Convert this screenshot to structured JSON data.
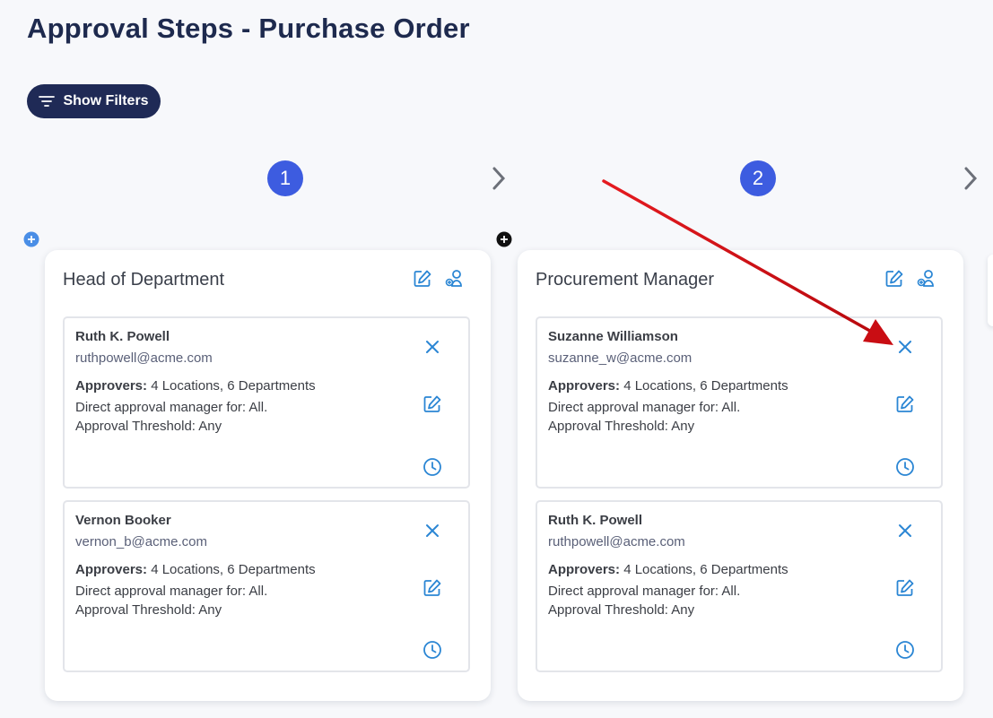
{
  "page": {
    "title": "Approval Steps - Purchase Order"
  },
  "toolbar": {
    "show_filters_label": "Show Filters"
  },
  "colors": {
    "accent": "#3d5ce0",
    "dark": "#1f2a56",
    "icon_blue": "#2b86d4",
    "annotation_arrow": "#d7141a"
  },
  "steps": [
    {
      "number": "1",
      "title": "Head of Department",
      "approvers": [
        {
          "name": "Ruth K. Powell",
          "email": "ruthpowell@acme.com",
          "approvers_label": "Approvers:",
          "approvers_value": "4 Locations, 6 Departments",
          "direct": "Direct approval manager for: All.",
          "threshold": "Approval Threshold: Any"
        },
        {
          "name": "Vernon Booker",
          "email": "vernon_b@acme.com",
          "approvers_label": "Approvers:",
          "approvers_value": "4 Locations, 6 Departments",
          "direct": "Direct approval manager for: All.",
          "threshold": "Approval Threshold: Any"
        }
      ]
    },
    {
      "number": "2",
      "title": "Procurement Manager",
      "approvers": [
        {
          "name": "Suzanne Williamson",
          "email": "suzanne_w@acme.com",
          "approvers_label": "Approvers:",
          "approvers_value": "4 Locations, 6 Departments",
          "direct": "Direct approval manager for: All.",
          "threshold": "Approval Threshold: Any"
        },
        {
          "name": "Ruth K. Powell",
          "email": "ruthpowell@acme.com",
          "approvers_label": "Approvers:",
          "approvers_value": "4 Locations, 6 Departments",
          "direct": "Direct approval manager for: All.",
          "threshold": "Approval Threshold: Any"
        }
      ]
    }
  ],
  "icons": {
    "filter": "filter-lines-icon",
    "next": "chevron-right-icon",
    "add": "plus-circle-icon",
    "edit": "edit-icon",
    "add_user": "add-user-icon",
    "remove": "close-icon",
    "history": "clock-icon"
  }
}
